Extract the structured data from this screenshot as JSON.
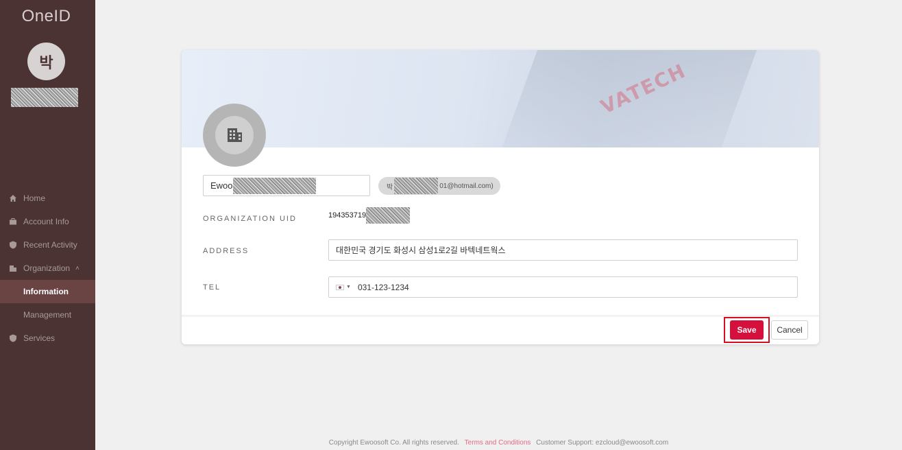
{
  "sidebar": {
    "brand": "OneID",
    "avatar_initial": "박",
    "items": [
      {
        "label": "Home",
        "icon": "home-icon"
      },
      {
        "label": "Account Info",
        "icon": "briefcase-icon"
      },
      {
        "label": "Recent Activity",
        "icon": "shield-icon"
      },
      {
        "label": "Organization",
        "icon": "building-icon"
      },
      {
        "label": "Information"
      },
      {
        "label": "Management"
      },
      {
        "label": "Services",
        "icon": "shield-icon"
      }
    ]
  },
  "org": {
    "name_prefix": "Ewoo",
    "email_prefix": "박",
    "email_suffix": "01@hotmail.com)",
    "uid_label": "ORGANIZATION UID",
    "uid_prefix": "194353719",
    "address_label": "ADDRESS",
    "address_value": "대한민국 경기도 화성시 삼성1로2길 바텍네트웍스",
    "tel_label": "TEL",
    "tel_value": "031-123-1234"
  },
  "actions": {
    "save": "Save",
    "cancel": "Cancel"
  },
  "footer": {
    "copyright": "Copyright Ewoosoft Co. All rights reserved.",
    "terms": "Terms and Conditions",
    "support": "Customer Support: ezcloud@ewoosoft.com"
  },
  "colors": {
    "sidebar_bg": "#4a3332",
    "accent": "#d5103c"
  }
}
